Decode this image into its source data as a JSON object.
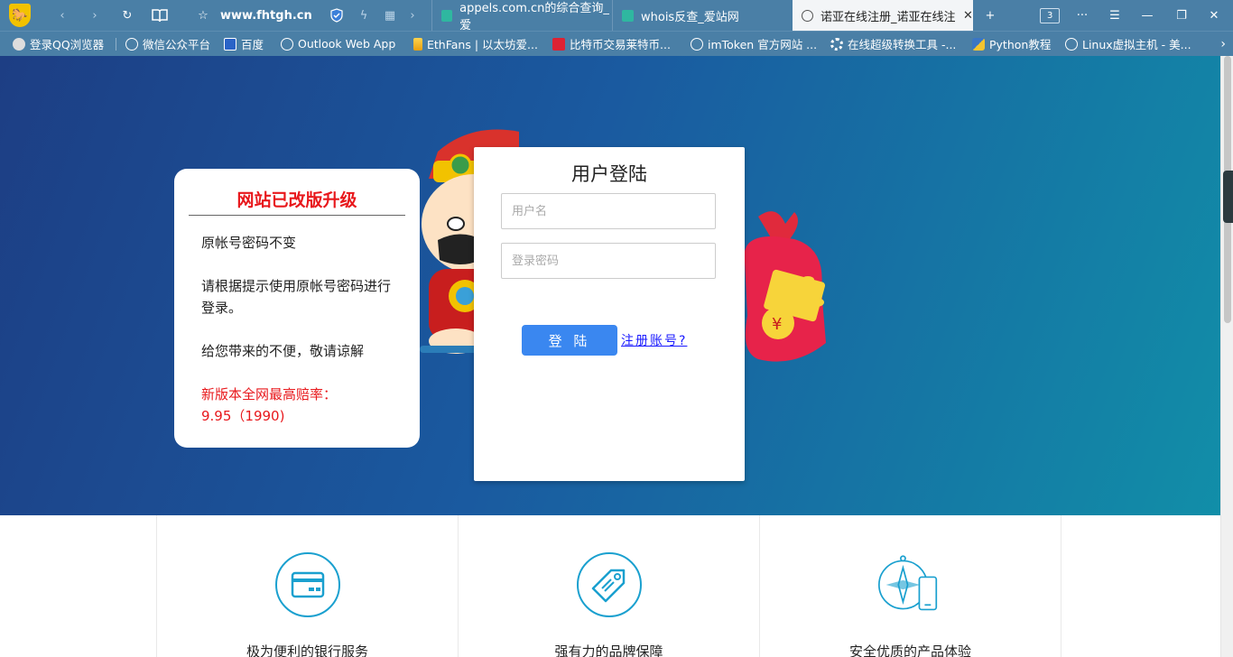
{
  "browser": {
    "logo_glyph": "🐎",
    "url": "www.fhtgh.cn",
    "tabs": [
      {
        "title": "appels.com.cn的综合查询_爱"
      },
      {
        "title": "whois反查_爱站网"
      },
      {
        "title": "诺亚在线注册_诺亚在线注册"
      }
    ],
    "tab_count": "3",
    "new_tab": "+",
    "menu_dots": "···"
  },
  "bookmarks": [
    {
      "label": "登录QQ浏览器"
    },
    {
      "label": "微信公众平台"
    },
    {
      "label": "百度"
    },
    {
      "label": "Outlook Web App"
    },
    {
      "label": "EthFans | 以太坊爱..."
    },
    {
      "label": "比特币交易莱特币..."
    },
    {
      "label": "imToken 官方网站 ..."
    },
    {
      "label": "在线超级转换工具 -..."
    },
    {
      "label": "Python教程"
    },
    {
      "label": "Linux虚拟主机 - 美..."
    }
  ],
  "notice": {
    "title": "网站已改版升级",
    "line1": "原帐号密码不变",
    "line2": "请根据提示使用原帐号密码进行登录。",
    "line3": "给您带来的不便，敬请谅解",
    "line4a": "新版本全网最高赔率：",
    "line4b": "9.95（1990)"
  },
  "login": {
    "title": "用户登陆",
    "username_placeholder": "用户名",
    "password_placeholder": "登录密码",
    "submit_label": "登 陆",
    "register_link": "注册账号?"
  },
  "features": [
    {
      "label": "极为便利的银行服务",
      "icon": "credit-card-icon"
    },
    {
      "label": "强有力的品牌保障",
      "icon": "price-tag-icon"
    },
    {
      "label": "安全优质的产品体验",
      "icon": "compass-mobile-icon"
    }
  ],
  "colors": {
    "accent_red": "#e8181c",
    "button_blue": "#3a87f0",
    "feature_blue": "#1aa0cf"
  }
}
